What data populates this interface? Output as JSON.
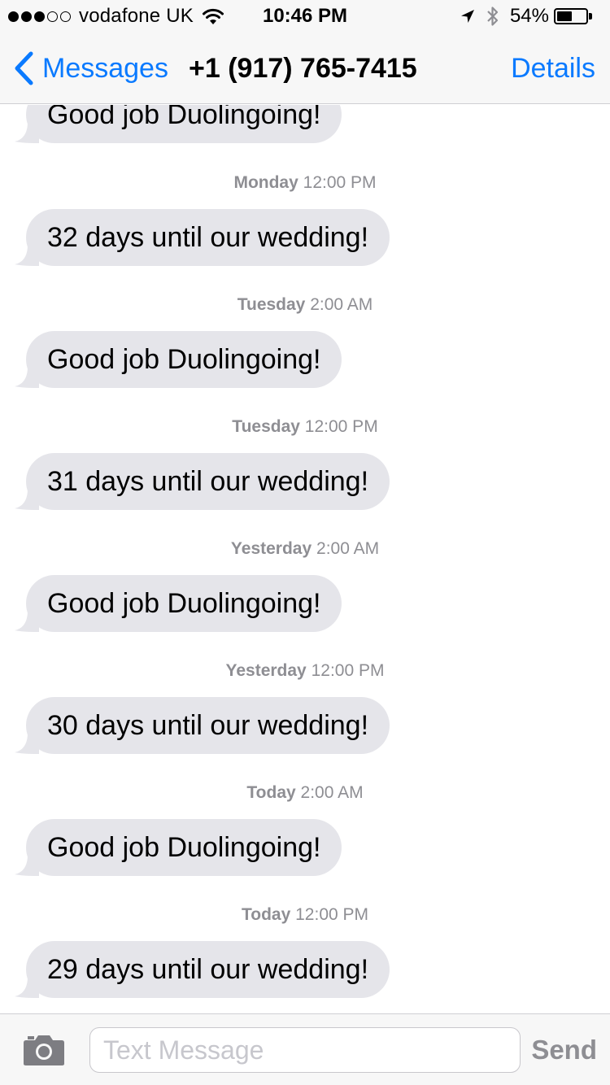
{
  "status_bar": {
    "carrier": "vodafone UK",
    "time": "10:46 PM",
    "battery_percent": "54%",
    "battery_level": 0.54,
    "signal_bars_filled": 3,
    "signal_bars_total": 5,
    "icons": [
      "wifi-icon",
      "location-arrow-icon",
      "bluetooth-icon",
      "battery-icon"
    ]
  },
  "nav": {
    "back_label": "Messages",
    "title": "+1 (917) 765-7415",
    "details_label": "Details",
    "accent_color": "#0a7aff"
  },
  "thread": {
    "partial_message": "Good job Duolingoing!",
    "items": [
      {
        "day": "Monday",
        "time": "12:00 PM",
        "text": "32 days until our wedding!"
      },
      {
        "day": "Tuesday",
        "time": "2:00 AM",
        "text": "Good job Duolingoing!"
      },
      {
        "day": "Tuesday",
        "time": "12:00 PM",
        "text": "31 days until our wedding!"
      },
      {
        "day": "Yesterday",
        "time": "2:00 AM",
        "text": "Good job Duolingoing!"
      },
      {
        "day": "Yesterday",
        "time": "12:00 PM",
        "text": "30 days until our wedding!"
      },
      {
        "day": "Today",
        "time": "2:00 AM",
        "text": "Good job Duolingoing!"
      },
      {
        "day": "Today",
        "time": "12:00 PM",
        "text": "29 days until our wedding!"
      }
    ],
    "bubble_color": "#e5e5ea"
  },
  "input_bar": {
    "placeholder": "Text Message",
    "send_label": "Send",
    "camera_icon": "camera-icon"
  }
}
